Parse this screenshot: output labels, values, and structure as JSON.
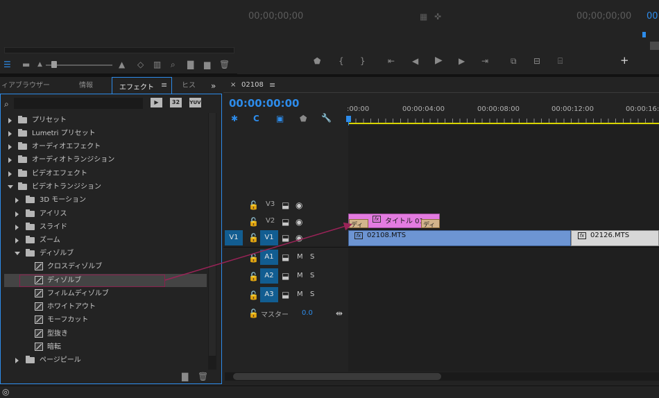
{
  "source_monitor": {
    "timecode": "00;00;00;00",
    "end_timecode": "00;00;00;00"
  },
  "program_monitor": {
    "timecode": "00"
  },
  "tabs": [
    {
      "label": "ィアブラウザー"
    },
    {
      "label": "情報"
    },
    {
      "label": "エフェクト"
    },
    {
      "label": "ヒス"
    }
  ],
  "effects_panel": {
    "search_placeholder": "",
    "tree": [
      {
        "label": "プリセット"
      },
      {
        "label": "Lumetri プリセット"
      },
      {
        "label": "オーディオエフェクト"
      },
      {
        "label": "オーディオトランジション"
      },
      {
        "label": "ビデオエフェクト"
      },
      {
        "label": "ビデオトランジション"
      },
      {
        "label": "3D モーション"
      },
      {
        "label": "アイリス"
      },
      {
        "label": "スライド"
      },
      {
        "label": "ズーム"
      },
      {
        "label": "ディゾルブ"
      },
      {
        "label": "クロスディゾルブ"
      },
      {
        "label": "ディゾルブ"
      },
      {
        "label": "フィルムディゾルブ"
      },
      {
        "label": "ホワイトアウト"
      },
      {
        "label": "モーフカット"
      },
      {
        "label": "型抜き"
      },
      {
        "label": "暗転"
      },
      {
        "label": "ページピール"
      }
    ]
  },
  "timeline": {
    "sequence_name": "02108",
    "timecode": "00:00:00:00",
    "ruler": [
      ":00:00",
      "00:00:04:00",
      "00:00:08:00",
      "00:00:12:00",
      "00:00:16:"
    ],
    "tracks": {
      "v3": "V3",
      "v2": "V2",
      "v1": "V1",
      "v1_source": "V1",
      "a1": "A1",
      "a2": "A2",
      "a3": "A3",
      "m": "M",
      "s": "S",
      "master": "マスター",
      "master_value": "0.0"
    },
    "clips": {
      "title_clip": "タイトル 01",
      "transition_left": "ディ",
      "transition_right": "ディ",
      "video_clip_1": "02108.MTS",
      "video_clip_2": "02126.MTS",
      "fx": "fx"
    }
  },
  "colors": {
    "accent_blue": "#2d8ceb",
    "title_clip": "#e37be0",
    "video_clip": "#6d95d3",
    "highlight_box": "#8a1f4c"
  }
}
